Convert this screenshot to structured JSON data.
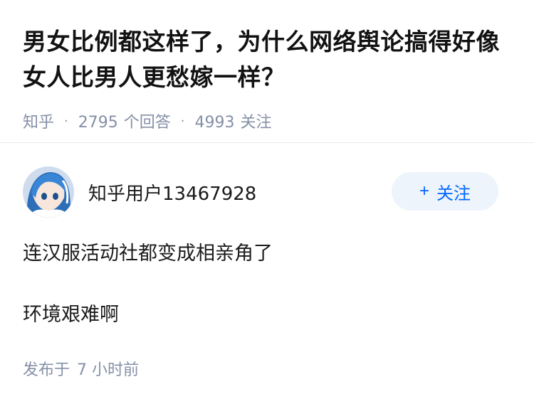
{
  "question": {
    "title": "男女比例都这样了，为什么网络舆论搞得好像女人比男人更愁嫁一样？",
    "source": "知乎",
    "answers_count": "2795",
    "answers_label": "个回答",
    "followers_count": "4993",
    "followers_label": "关注"
  },
  "answer": {
    "author_name": "知乎用户13467928",
    "follow_button": {
      "icon": "plus-icon",
      "label": "关注"
    },
    "paragraphs": [
      "连汉服活动社都变成相亲角了",
      "环境艰难啊"
    ],
    "published_label": "发布于",
    "published_time": "7 小时前"
  },
  "colors": {
    "title": "#121212",
    "meta": "#8590a6",
    "accent": "#0066ff",
    "follow_bg": "#eef4fb"
  }
}
